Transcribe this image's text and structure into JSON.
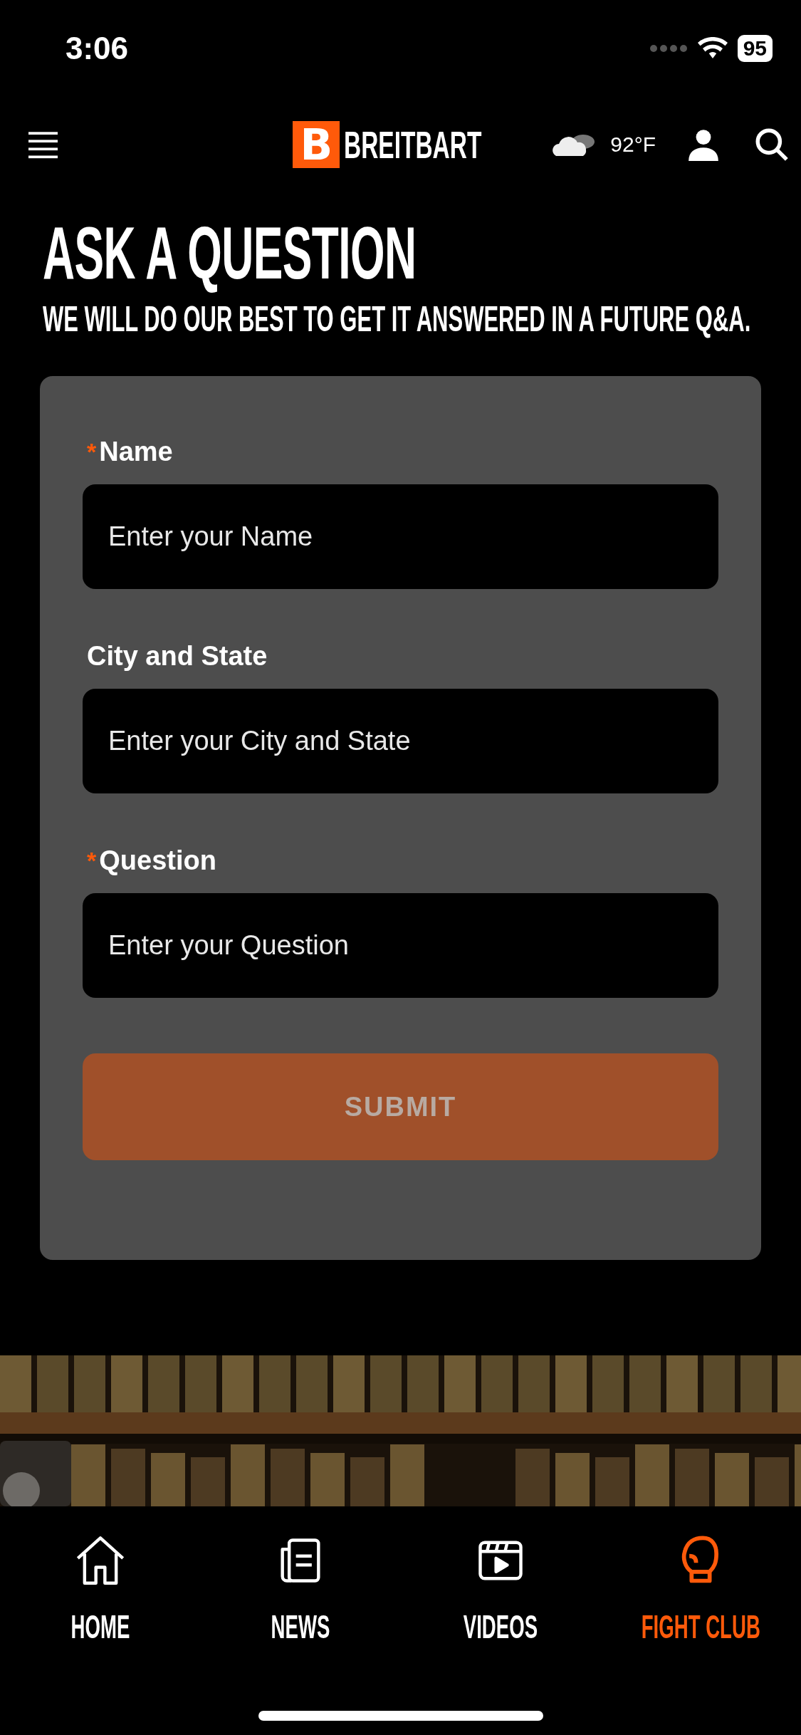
{
  "status_bar": {
    "time": "3:06",
    "battery": "95"
  },
  "header": {
    "logo_mark": "B",
    "logo_text": "BREITBART",
    "temperature": "92°F"
  },
  "page": {
    "title": "ASK A QUESTION",
    "subtitle": "WE WILL DO OUR BEST TO GET IT ANSWERED IN A FUTURE Q&A."
  },
  "form": {
    "fields": [
      {
        "label": "Name",
        "required": true,
        "required_mark": "*",
        "placeholder": "Enter your Name"
      },
      {
        "label": "City and State",
        "required": false,
        "placeholder": "Enter your City and State"
      },
      {
        "label": "Question",
        "required": true,
        "required_mark": "*",
        "placeholder": "Enter your Question"
      }
    ],
    "submit": {
      "label": "SUBMIT",
      "disabled": true
    }
  },
  "tab_bar": [
    {
      "kind": "home",
      "label": "HOME",
      "selected": false
    },
    {
      "kind": "news",
      "label": "NEWS",
      "selected": false
    },
    {
      "kind": "videos",
      "label": "VIDEOS",
      "selected": false
    },
    {
      "kind": "fight",
      "label": "FIGHT CLUB",
      "selected": true
    }
  ]
}
